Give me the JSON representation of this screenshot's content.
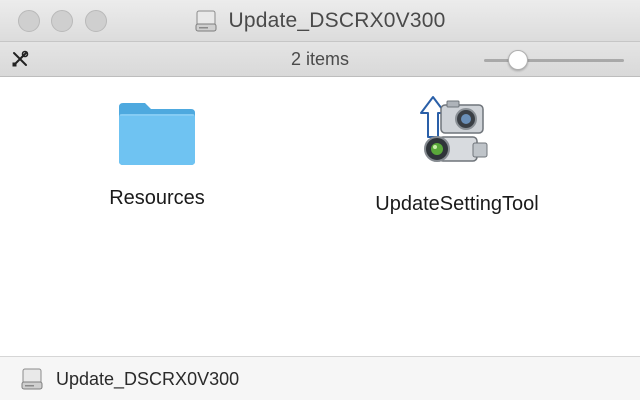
{
  "window": {
    "title": "Update_DSCRX0V300",
    "title_icon": "drive-icon"
  },
  "toolbar": {
    "items_count": "2 items",
    "tool_icon": "tools-icon",
    "icon_size_slider": 0.2
  },
  "files": [
    {
      "name": "Resources",
      "icon": "folder-icon"
    },
    {
      "name": "UpdateSettingTool",
      "icon": "camera-update-app-icon"
    }
  ],
  "pathbar": {
    "label": "Update_DSCRX0V300",
    "icon": "drive-icon"
  },
  "colors": {
    "folder": "#6fc3f2",
    "folder_tab": "#4ea9df"
  }
}
